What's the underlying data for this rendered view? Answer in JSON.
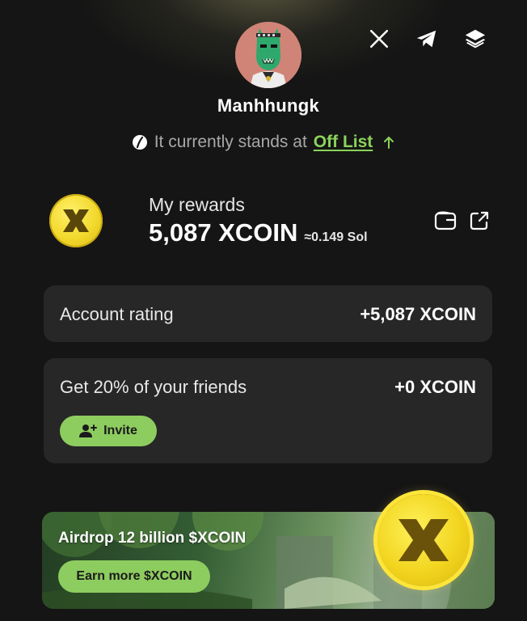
{
  "profile": {
    "username": "Manhhungk",
    "avatar_bg": "#cf8477"
  },
  "social": {
    "icons": [
      "x-icon",
      "telegram-icon",
      "layers-icon"
    ]
  },
  "standing": {
    "prefix": "It currently stands at",
    "status_link": "Off List"
  },
  "rewards": {
    "label": "My rewards",
    "amount": "5,087 XCOIN",
    "approx": "≈0.149 Sol"
  },
  "account_rating": {
    "label": "Account rating",
    "value": "+5,087 XCOIN"
  },
  "referral": {
    "label": "Get 20% of your friends",
    "value": "+0 XCOIN",
    "invite_label": "Invite"
  },
  "banner": {
    "title": "Airdrop 12 billion $XCOIN",
    "button_label": "Earn more $XCOIN"
  },
  "colors": {
    "background": "#151515",
    "card": "#272727",
    "accent_green": "#8dcc5f",
    "coin_yellow": "#f2d92c"
  }
}
